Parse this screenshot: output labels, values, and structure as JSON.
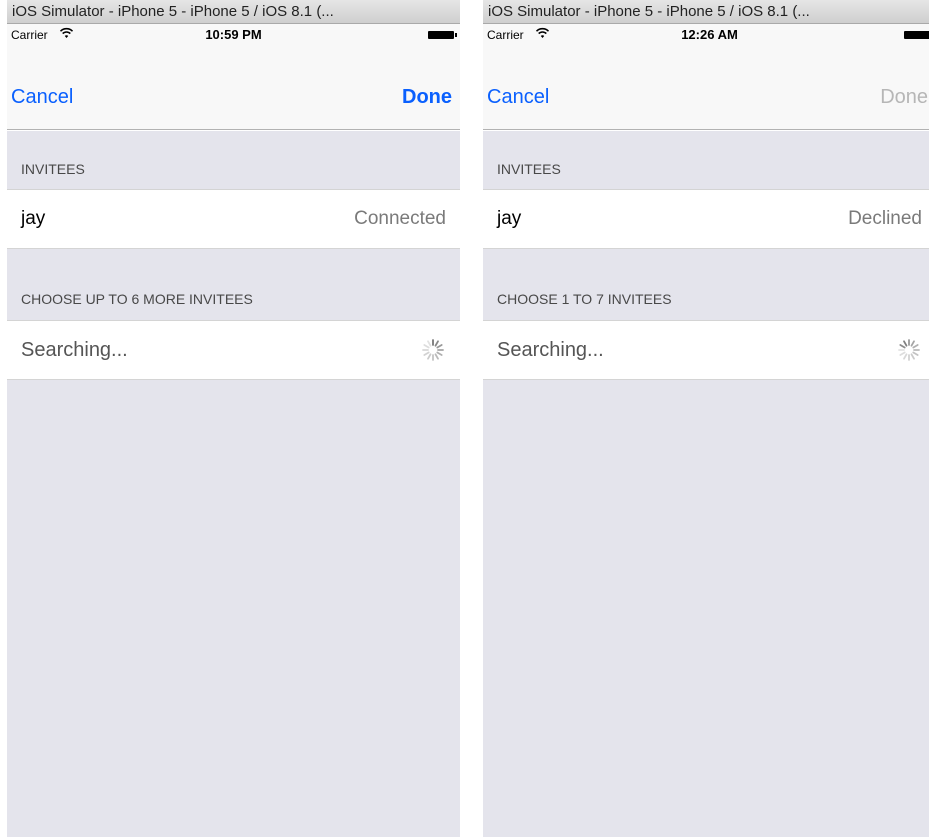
{
  "screens": [
    {
      "window_title": "iOS Simulator - iPhone 5 - iPhone 5 / iOS 8.1 (...",
      "status": {
        "carrier": "Carrier",
        "time": "10:59 PM"
      },
      "nav": {
        "cancel": "Cancel",
        "done": "Done",
        "done_state": "enabled"
      },
      "section_invitees": "INVITEES",
      "invitee": {
        "name": "jay",
        "status": "Connected"
      },
      "section_choose": "CHOOSE UP TO 6 MORE INVITEES",
      "searching": "Searching..."
    },
    {
      "window_title": "iOS Simulator - iPhone 5 - iPhone 5 / iOS 8.1 (...",
      "status": {
        "carrier": "Carrier",
        "time": "12:26 AM"
      },
      "nav": {
        "cancel": "Cancel",
        "done": "Done",
        "done_state": "disabled"
      },
      "section_invitees": "INVITEES",
      "invitee": {
        "name": "jay",
        "status": "Declined"
      },
      "section_choose": "CHOOSE 1 TO 7 INVITEES",
      "searching": "Searching..."
    }
  ],
  "colors": {
    "tint": "#0a60fe",
    "disabled": "#b6b6b6",
    "group_background": "#e4e4ec"
  },
  "icons": [
    "wifi-icon",
    "battery-icon",
    "activity-spinner-icon"
  ]
}
